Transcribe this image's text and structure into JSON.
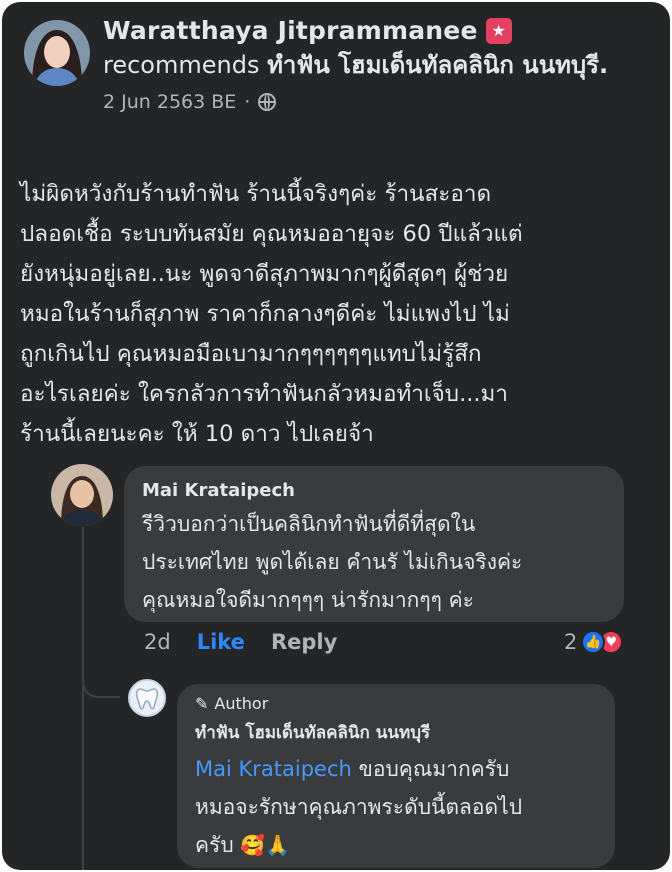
{
  "post": {
    "author": "Waratthaya Jitprammanee",
    "recommends_word": "recommends",
    "page_name": "ทำฟัน โฮมเด็นทัลคลินิก นนทบุรี.",
    "date": "2 Jun 2563 BE",
    "separator": "·",
    "review_text": "ไม่ผิดหวังกับร้านทำฟัน ร้านนี้จริงๆค่ะ ร้านสะอาด\nปลอดเชื้อ ระบบทันสมัย คุณหมออายุจะ 60 ปีแล้วแต่\nยังหนุ่มอยู่เลย..นะ พูดจาดีสุภาพมากๆผู้ดีสุดๆ ผู้ช่วย\nหมอในร้านก็สุภาพ ราคาก็กลางๆดีค่ะ ไม่แพงไป ไม่\nถูกเกินไป คุณหมอมือเบามากๆๆๆๆๆๆแทบไม่รู้สึก\nอะไรเลยค่ะ ใครกลัวการทำฟันกลัวหมอทำเจ็บ...มา\nร้านนี้เลยนะคะ ให้ 10 ดาว ไปเลยจ้า",
    "badge_symbol": "★"
  },
  "comment": {
    "author": "Mai Krataipech",
    "text": "รีวิวบอกว่าเป็นคลินิกทำฟันที่ดีที่สุดใน\nประเทศไทย พูดได้เลย คำนรั ไม่เกินจริงค่ะ\nคุณหมอใจดีมากๆๆๆ น่ารักมากๆๆ ค่ะ",
    "time": "2d",
    "like_label": "Like",
    "reply_label": "Reply",
    "reaction_count": "2",
    "like_symbol": "👍",
    "love_symbol": "♥"
  },
  "reply": {
    "author_badge": "Author",
    "author_badge_icon": "✎",
    "author": "ทำฟัน โฮมเด็นทัลคลินิก นนทบุรี",
    "mention": "Mai Krataipech",
    "text_after_mention": " ขอบคุณมากครับ",
    "text_line2": "หมอจะรักษาคุณภาพระดับนี้ตลอดไป",
    "text_line3": "ครับ",
    "emojis": "🥰🙏"
  },
  "colors": {
    "background": "#242526",
    "bubble": "#3a3b3c",
    "primary_text": "#e4e6eb",
    "secondary_text": "#b0b3b8",
    "link_blue": "#2d88ff",
    "badge_pink": "#e4405f"
  }
}
